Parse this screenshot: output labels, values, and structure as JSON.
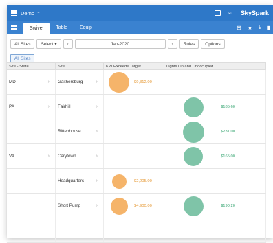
{
  "topbar": {
    "app_name": "Demo",
    "user": "su",
    "brand": "SkySpark"
  },
  "nav": {
    "tabs": [
      "Swivel",
      "Table",
      "Equip"
    ],
    "active": "Swivel"
  },
  "toolbar": {
    "all_sites": "All Sites",
    "select": "Select ▾",
    "prev": "‹",
    "date": "Jan-2020",
    "next": "›",
    "rules": "Rules",
    "options": "Options"
  },
  "chip": "All Sites",
  "table": {
    "headers": [
      "Site - State",
      "Site",
      "KW Exceeds Target",
      "Lights On and Unoccupied"
    ],
    "rows": [
      {
        "state": "MD",
        "site": "Gaithersburg",
        "kw": "$9,312.00",
        "kw_level": 0.9,
        "lights": "",
        "lights_level": 0
      },
      {
        "state": "PA",
        "site": "Fairhill",
        "kw": "",
        "kw_level": 0,
        "lights": "$185.60",
        "lights_level": 0.85
      },
      {
        "state": "",
        "site": "Rittenhouse",
        "kw": "",
        "kw_level": 0,
        "lights": "$231.00",
        "lights_level": 0.95
      },
      {
        "state": "VA",
        "site": "Carytown",
        "kw": "",
        "kw_level": 0,
        "lights": "$165.00",
        "lights_level": 0.8
      },
      {
        "state": "",
        "site": "Headquarters",
        "kw": "$2,205.00",
        "kw_level": 0.5,
        "lights": "",
        "lights_level": 0
      },
      {
        "state": "",
        "site": "Short Pump",
        "kw": "$4,900.00",
        "kw_level": 0.7,
        "lights": "$190.20",
        "lights_level": 0.85
      }
    ]
  }
}
